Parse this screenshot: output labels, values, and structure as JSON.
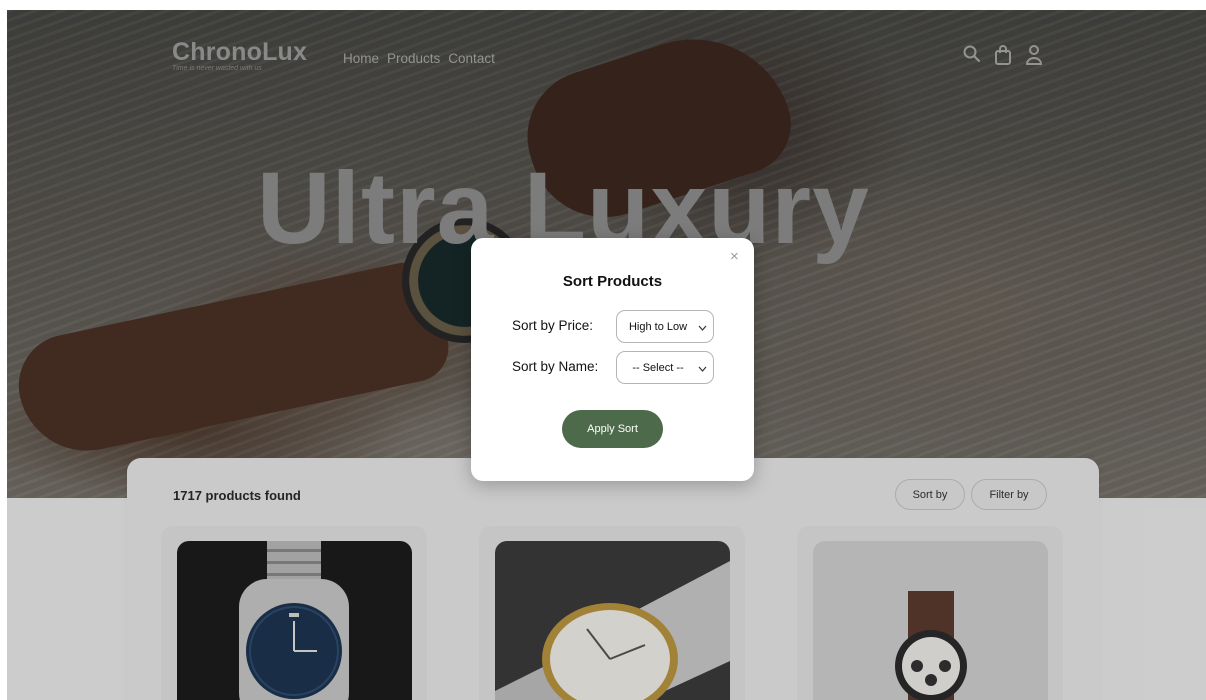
{
  "header": {
    "brand_name": "ChronoLux",
    "tagline": "Time is never wasted with us",
    "nav": [
      "Home",
      "Products",
      "Contact"
    ],
    "icons": [
      "search-icon",
      "shopping-bag-icon",
      "user-icon"
    ]
  },
  "hero": {
    "title": "Ultra Luxury"
  },
  "products": {
    "count_text": "1717 products found",
    "sort_label": "Sort by",
    "filter_label": "Filter by"
  },
  "modal": {
    "title": "Sort Products",
    "close_glyph": "×",
    "price_label": "Sort by Price:",
    "price_value": "High to Low",
    "name_label": "Sort by Name:",
    "name_value": "-- Select --",
    "apply_label": "Apply Sort"
  },
  "colors": {
    "accent": "#4d6b4b"
  }
}
